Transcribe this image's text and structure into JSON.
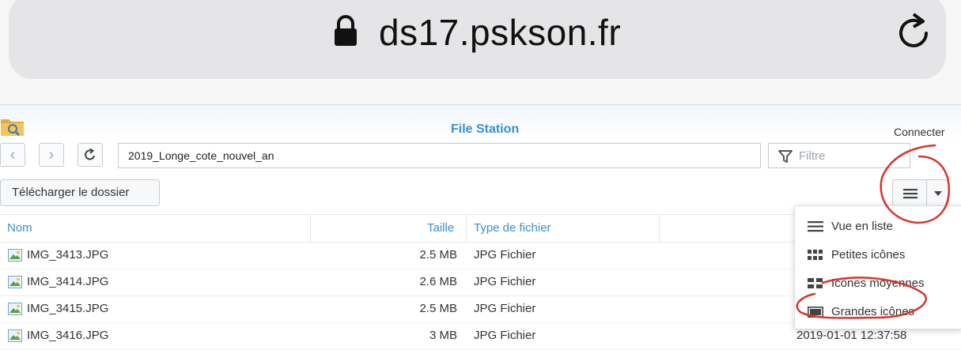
{
  "browser": {
    "url": "ds17.pskson.fr"
  },
  "app": {
    "title": "File Station",
    "connect_label": "Connecter"
  },
  "toolbar": {
    "path": "2019_Longe_cote_nouvel_an",
    "filter_placeholder": "Filtre",
    "download_label": "Télécharger le dossier"
  },
  "table": {
    "headers": {
      "name": "Nom",
      "size": "Taille",
      "type": "Type de fichier"
    },
    "rows": [
      {
        "name": "IMG_3413.JPG",
        "size": "2.5 MB",
        "type": "JPG Fichier",
        "date": ""
      },
      {
        "name": "IMG_3414.JPG",
        "size": "2.6 MB",
        "type": "JPG Fichier",
        "date": ""
      },
      {
        "name": "IMG_3415.JPG",
        "size": "2.5 MB",
        "type": "JPG Fichier",
        "date": ""
      },
      {
        "name": "IMG_3416.JPG",
        "size": "3 MB",
        "type": "JPG Fichier",
        "date": "2019-01-01 12:37:58"
      }
    ]
  },
  "view_menu": {
    "items": [
      {
        "label": "Vue en liste",
        "icon": "list-icon"
      },
      {
        "label": "Petites icônes",
        "icon": "small-grid-icon"
      },
      {
        "label": "Icônes moyennes",
        "icon": "medium-grid-icon"
      },
      {
        "label": "Grandes icônes",
        "icon": "large-icon"
      }
    ]
  },
  "colors": {
    "accent": "#3a8fd3",
    "annotation": "#d9342b"
  }
}
